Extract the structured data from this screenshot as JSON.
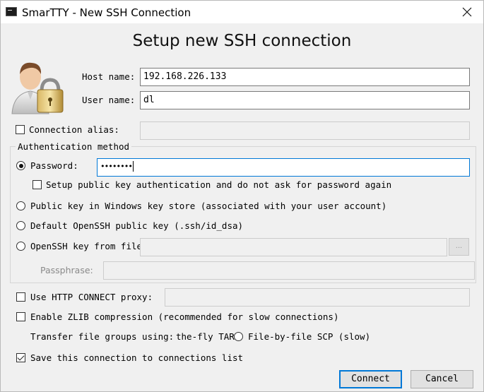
{
  "window": {
    "title": "SmarTTY - New SSH Connection"
  },
  "heading": "Setup new SSH connection",
  "host": {
    "label": "Host name:",
    "value": "192.168.226.133"
  },
  "user": {
    "label": "User name:",
    "value": "dl"
  },
  "alias": {
    "label": "Connection alias:",
    "checked": false,
    "value": ""
  },
  "auth": {
    "group_title": "Authentication method",
    "password": {
      "label": "Password:",
      "selected": true,
      "masked_value": "••••••••"
    },
    "setup_pubkey": {
      "label": "Setup public key authentication and do not ask for password again",
      "checked": false
    },
    "windows_store": {
      "label": "Public key in Windows key store (associated with your user account)",
      "selected": false
    },
    "default_openssh": {
      "label": "Default OpenSSH public key (.ssh/id_dsa)",
      "selected": false
    },
    "openssh_file": {
      "label": "OpenSSH key from file:",
      "selected": false,
      "value": "",
      "browse_label": "..."
    },
    "passphrase": {
      "label": "Passphrase:",
      "value": ""
    }
  },
  "http_proxy": {
    "label": "Use HTTP CONNECT proxy:",
    "checked": false,
    "value": ""
  },
  "zlib": {
    "label": "Enable ZLIB compression (recommended for slow connections)",
    "checked": false
  },
  "transfer": {
    "label": "Transfer file groups using:",
    "option_onthefly": "the-fly TAR",
    "option_filebyfile": "File-by-file SCP (slow)"
  },
  "save_conn": {
    "label": "Save this connection to connections list",
    "checked": true
  },
  "buttons": {
    "connect": "Connect",
    "cancel": "Cancel"
  },
  "colors": {
    "focus_border": "#0078d7",
    "background": "#f0f0f0"
  }
}
